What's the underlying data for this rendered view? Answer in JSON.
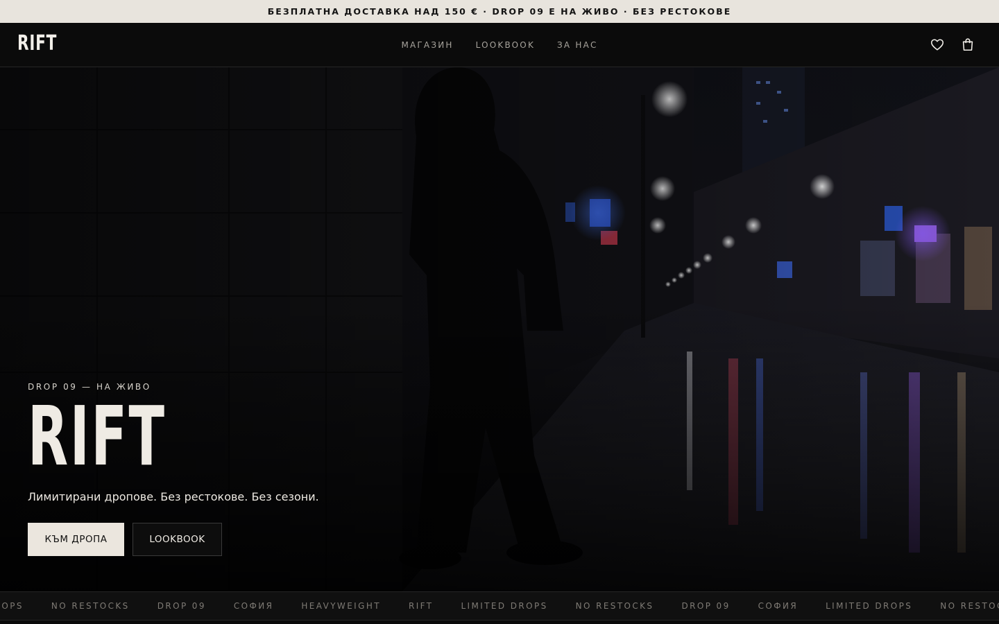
{
  "announcement": "БЕЗПЛАТНА ДОСТАВКА НАД 150 € · DROP 09 Е НА ЖИВО · БЕЗ РЕСТОКОВЕ",
  "header": {
    "logo": "RIFT",
    "menu": [
      "МАГАЗИН",
      "LOOKBOOK",
      "ЗА НАС"
    ],
    "icons": [
      "heart-icon",
      "shopping-bag-icon"
    ]
  },
  "hero": {
    "eyebrow": "DROP 09 — НА ЖИВО",
    "title": "RIFT",
    "tagline": "Лимитирани дропове. Без рестокове. Без сезони.",
    "primary_cta": "КЪМ ДРОПА",
    "secondary_cta": "LOOKBOOK"
  },
  "marquee": [
    "DROPS",
    "NO RESTOCKS",
    "DROP 09",
    "СОФИЯ",
    "HEAVYWEIGHT",
    "RIFT",
    "LIMITED DROPS",
    "NO RESTOCKS",
    "DROP 09",
    "СОФИЯ",
    "LIMITED DROPS",
    "NO RESTOCKS"
  ],
  "colors": {
    "announcement_bg": "#e8e4dd",
    "background": "#0a0a0a",
    "primary_cta_bg": "#ebe6de",
    "text": "#f2efe9"
  }
}
